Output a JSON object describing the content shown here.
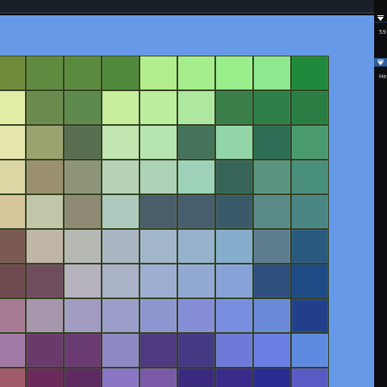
{
  "window": {
    "panel1_value": "59",
    "panel2_label": "He"
  },
  "board": {
    "rows": 9,
    "cols": 9,
    "tile_colors": [
      [
        "#6f8a3b",
        "#5f8a3f",
        "#5a8a3d",
        "#4f8a3b",
        "#b2ee8c",
        "#a6ee8c",
        "#9aee8c",
        "#8ee890",
        "#1f8a3b"
      ],
      [
        "#e2eea8",
        "#6b8a4e",
        "#5f8a4e",
        "#c6ee9c",
        "#bbee9f",
        "#aee8a0",
        "#3a7e4a",
        "#2e7e4a",
        "#2a7e44"
      ],
      [
        "#e6e6ac",
        "#9aa26e",
        "#5a6e50",
        "#c2e6b0",
        "#b6e6b0",
        "#44725a",
        "#92d6a8",
        "#2e6e56",
        "#4a9a70"
      ],
      [
        "#dcd6a4",
        "#9a9070",
        "#8e9478",
        "#b6d2b6",
        "#aed2b8",
        "#9ed2b8",
        "#366458",
        "#5a9480",
        "#4a8e7c"
      ],
      [
        "#d6c69c",
        "#c2c6a8",
        "#8e8a74",
        "#aecabe",
        "#4a5e6a",
        "#465e6e",
        "#3a5a6a",
        "#5a8a86",
        "#4a8684"
      ],
      [
        "#7a5a52",
        "#c0b6a6",
        "#b6b8b4",
        "#aab6c2",
        "#a2b6ca",
        "#96b2cc",
        "#84aecc",
        "#5e7e90",
        "#2a5a7e"
      ],
      [
        "#6e4a4e",
        "#6e4e5e",
        "#b6b2be",
        "#aab2c8",
        "#9eaed0",
        "#92aad2",
        "#86a2d6",
        "#2e4e7e",
        "#1e4a86"
      ],
      [
        "#a67a92",
        "#a696ac",
        "#a29cc2",
        "#9a9ec8",
        "#8e96d0",
        "#868ed8",
        "#7a8ee0",
        "#6a8ad8",
        "#22408a"
      ],
      [
        "#a07aa4",
        "#6a3a6a",
        "#6a3a72",
        "#8e88c4",
        "#4e3a7e",
        "#443a84",
        "#6e7ad8",
        "#6a7ee6",
        "#5e8ae0"
      ],
      [
        "#a05a6a",
        "#6a2a5a",
        "#5e2a62",
        "#8a76c4",
        "#7a5aa6",
        "#3a2a7e",
        "#3a2a8a",
        "#2a2a92",
        "#5a5ac4"
      ]
    ]
  }
}
